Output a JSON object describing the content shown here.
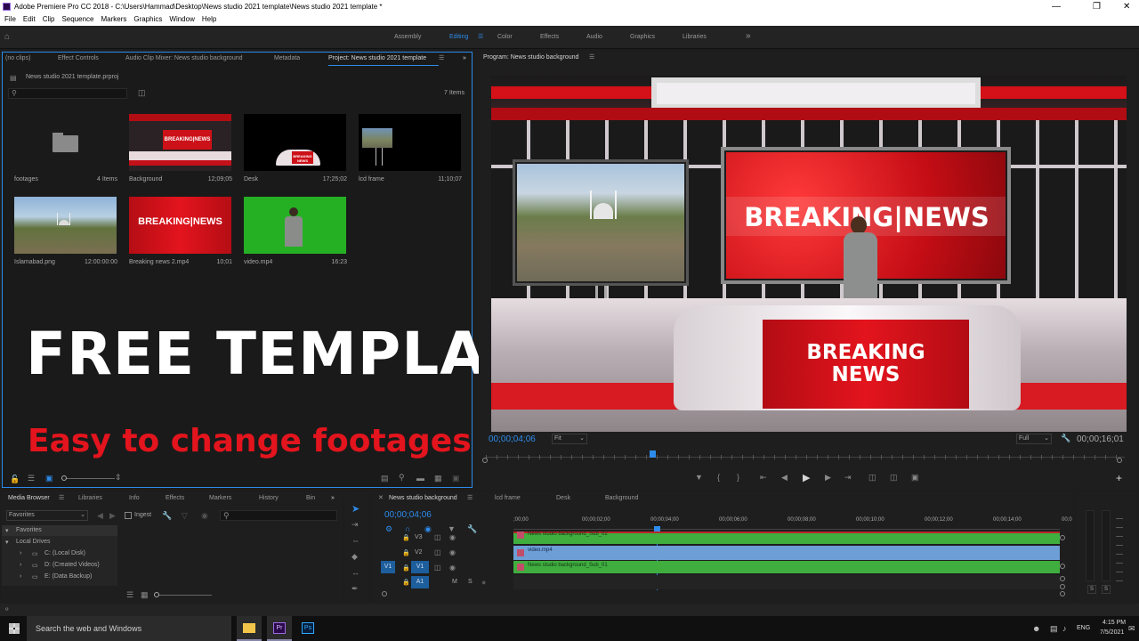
{
  "window": {
    "title": "Adobe Premiere Pro CC 2018 - C:\\Users\\Hammad\\Desktop\\News studio 2021 template\\News studio 2021 template *"
  },
  "menu": [
    "File",
    "Edit",
    "Clip",
    "Sequence",
    "Markers",
    "Graphics",
    "Window",
    "Help"
  ],
  "workspaces": {
    "items": [
      "Assembly",
      "Editing",
      "Color",
      "Effects",
      "Audio",
      "Graphics",
      "Libraries"
    ],
    "active": "Editing"
  },
  "project": {
    "tabs": [
      "(no clips)",
      "Effect Controls",
      "Audio Clip Mixer: News studio background",
      "Metadata",
      "Project: News studio 2021 template"
    ],
    "file": "News studio 2021 template.prproj",
    "item_count": "7 Items",
    "items": [
      {
        "name": "footages",
        "duration": "4 Items"
      },
      {
        "name": "Background",
        "duration": "12;09;05"
      },
      {
        "name": "Desk",
        "duration": "17;25;02"
      },
      {
        "name": "lcd frame",
        "duration": "11;10;07"
      },
      {
        "name": "Islamabad.png",
        "duration": "12:00:00:00"
      },
      {
        "name": "Breaking news 2.mp4",
        "duration": "10;01"
      },
      {
        "name": "video.mp4",
        "duration": "16:23"
      }
    ]
  },
  "overlay": {
    "headline": "FREE TEMPLATE",
    "subline": "Easy to change footages"
  },
  "program": {
    "tab": "Program: News studio background",
    "timecode_left": "00;00;04;06",
    "timecode_right": "00;00;16;01",
    "fit": "Fit",
    "resolution": "Full",
    "screen_text": "BREAKING|NEWS",
    "desk_text_1": "BREAKING",
    "desk_text_2": "NEWS",
    "thumb_text": "BREAKING|NEWS",
    "thumb_desk": "BREAKING NEWS"
  },
  "media": {
    "tabs": [
      "Media Browser",
      "Libraries",
      "Info",
      "Effects",
      "Markers",
      "History",
      "Bin"
    ],
    "filter": "Favorites",
    "ingest": "Ingest",
    "tree": [
      {
        "label": "Favorites"
      },
      {
        "label": "Local Drives"
      },
      {
        "label": "C: (Local Disk)"
      },
      {
        "label": "D: (Created Videos)"
      },
      {
        "label": "E: (Data Backup)"
      }
    ]
  },
  "timeline": {
    "tabs": [
      "News studio background",
      "lcd frame",
      "Desk",
      "Background"
    ],
    "timecode": "00;00;04;06",
    "ruler": [
      ";00;00",
      "00;00;02;00",
      "00;00;04;00",
      "00;00;06;00",
      "00;00;08;00",
      "00;00;10;00",
      "00;00;12;00",
      "00;00;14;00",
      "00;0"
    ],
    "tracks": [
      "V3",
      "V2",
      "V1",
      "A1"
    ],
    "src_v": "V1",
    "src_a": "A1",
    "clips": [
      "News studio background_Sub_02",
      "video.mp4",
      "News studio background_Sub_01"
    ],
    "m_label": "M",
    "s_label": "S"
  },
  "meter": {
    "labels": [
      "S",
      "S"
    ]
  },
  "taskbar": {
    "search": "Search the web and Windows",
    "lang": "ENG",
    "time": "4:15 PM",
    "date": "7/5/2021"
  },
  "colors": {
    "accent": "#2d8ceb",
    "red": "#e3141d",
    "clip_green": "#3fae3f",
    "clip_blue": "#6d9ed6"
  }
}
